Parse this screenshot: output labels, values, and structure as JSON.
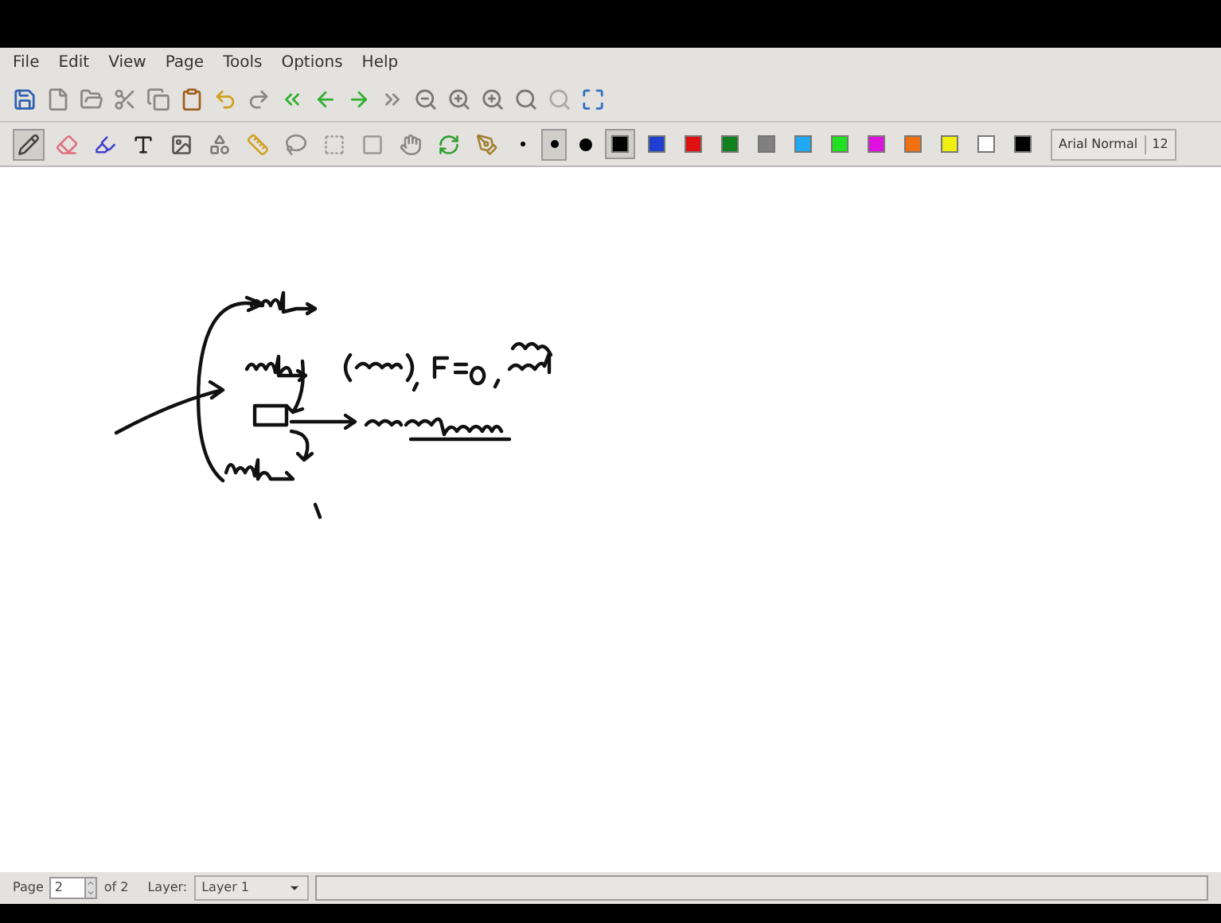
{
  "menu": [
    "File",
    "Edit",
    "View",
    "Page",
    "Tools",
    "Options",
    "Help"
  ],
  "tools": [
    {
      "selected": true
    },
    {
      "selected": false
    },
    {
      "selected": false
    },
    {
      "selected": false
    },
    {
      "selected": false
    },
    {
      "selected": false
    },
    {
      "selected": false
    },
    {
      "selected": false
    },
    {
      "selected": false
    },
    {
      "selected": false
    },
    {
      "selected": false
    },
    {
      "selected": false
    },
    {
      "selected": false
    }
  ],
  "pen_sizes": [
    {
      "selected": false
    },
    {
      "selected": true
    },
    {
      "selected": false
    }
  ],
  "colors": [
    {
      "color": "#000000",
      "selected": true
    },
    {
      "color": "#1f3fd0",
      "selected": false
    },
    {
      "color": "#e01010",
      "selected": false
    },
    {
      "color": "#108020",
      "selected": false
    },
    {
      "color": "#808080",
      "selected": false
    },
    {
      "color": "#20a8f0",
      "selected": false
    },
    {
      "color": "#20e020",
      "selected": false
    },
    {
      "color": "#e010e0",
      "selected": false
    },
    {
      "color": "#f07010",
      "selected": false
    },
    {
      "color": "#f0f010",
      "selected": false
    },
    {
      "color": "#ffffff",
      "selected": false
    },
    {
      "color": "#000000",
      "selected": false
    }
  ],
  "font": {
    "name": "Arial Normal",
    "size": "12"
  },
  "status_bar": {
    "page_label": "Page",
    "page": "2",
    "page_total": "of 2",
    "layer_label": "Layer:",
    "layer": "Layer 1"
  }
}
